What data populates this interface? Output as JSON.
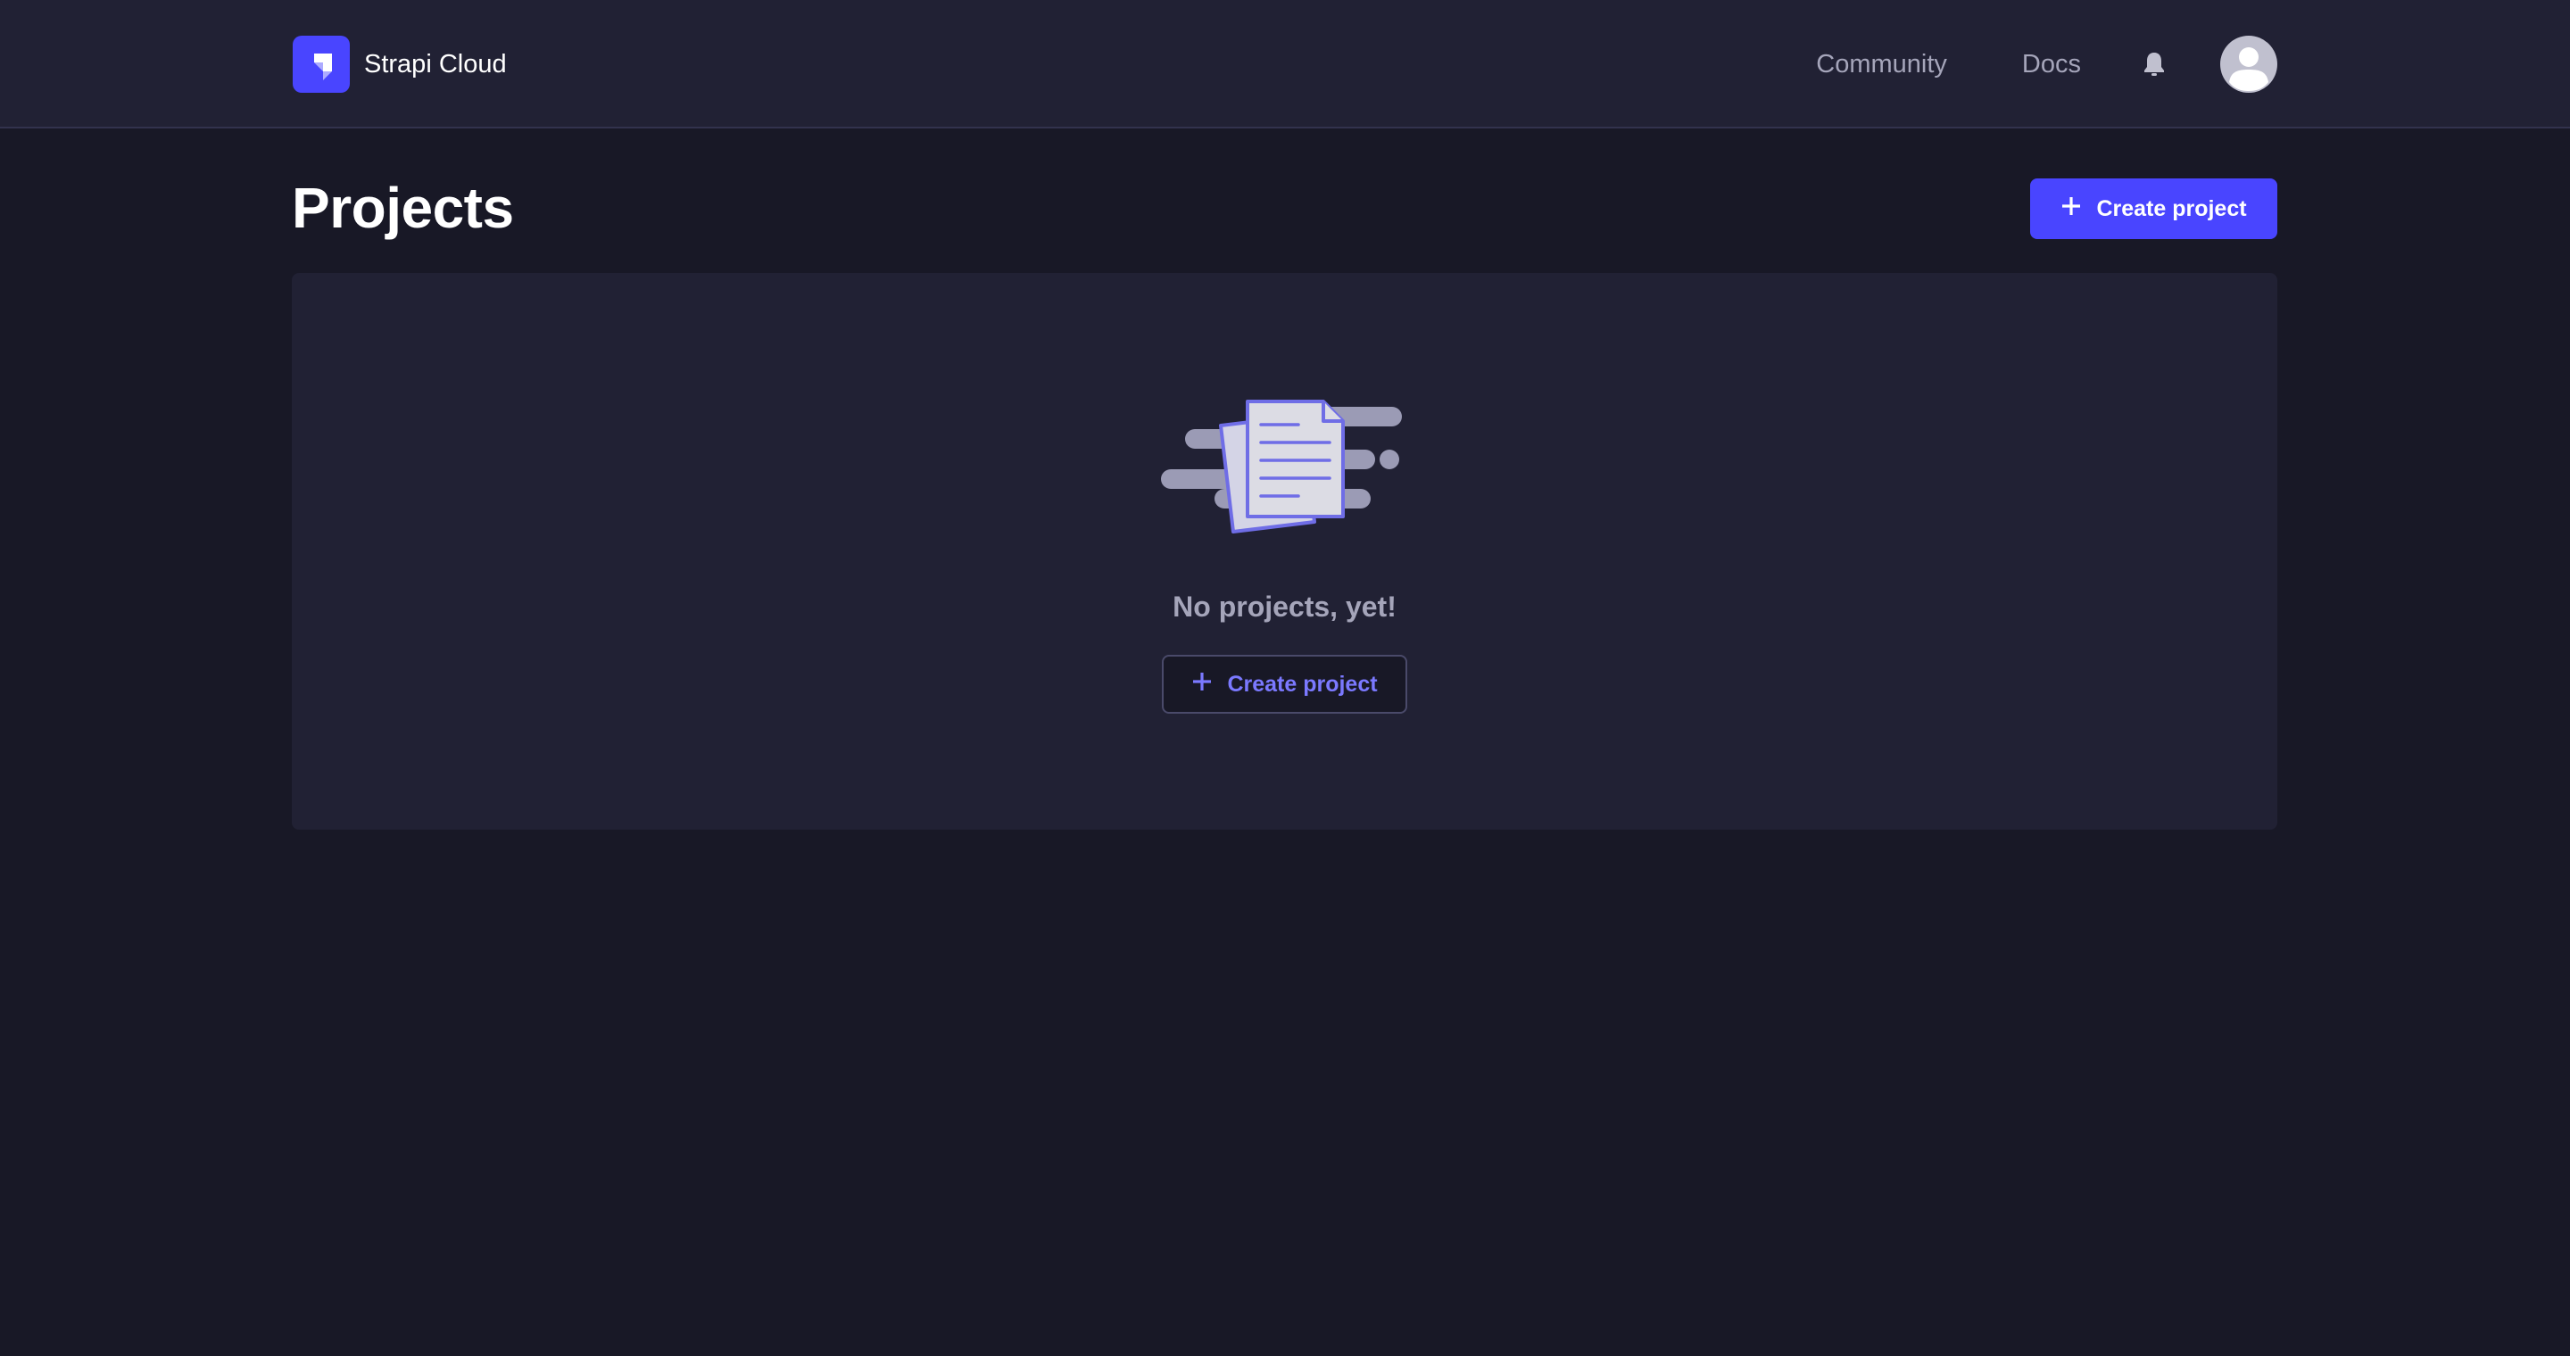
{
  "header": {
    "brand_name": "Strapi Cloud",
    "logo_icon": "strapi-logo-icon",
    "nav": [
      {
        "label": "Community"
      },
      {
        "label": "Docs"
      }
    ],
    "notifications_icon": "bell-icon",
    "avatar_icon": "user-avatar-icon"
  },
  "page": {
    "title": "Projects",
    "create_button_label": "Create project"
  },
  "empty_state": {
    "illustration": "documents-illustration",
    "message": "No projects, yet!",
    "create_button_label": "Create project"
  },
  "colors": {
    "primary": "#4945ff",
    "primary_text": "#7b79ff",
    "background": "#181826",
    "surface": "#212134",
    "muted_text": "#a5a5ba"
  }
}
